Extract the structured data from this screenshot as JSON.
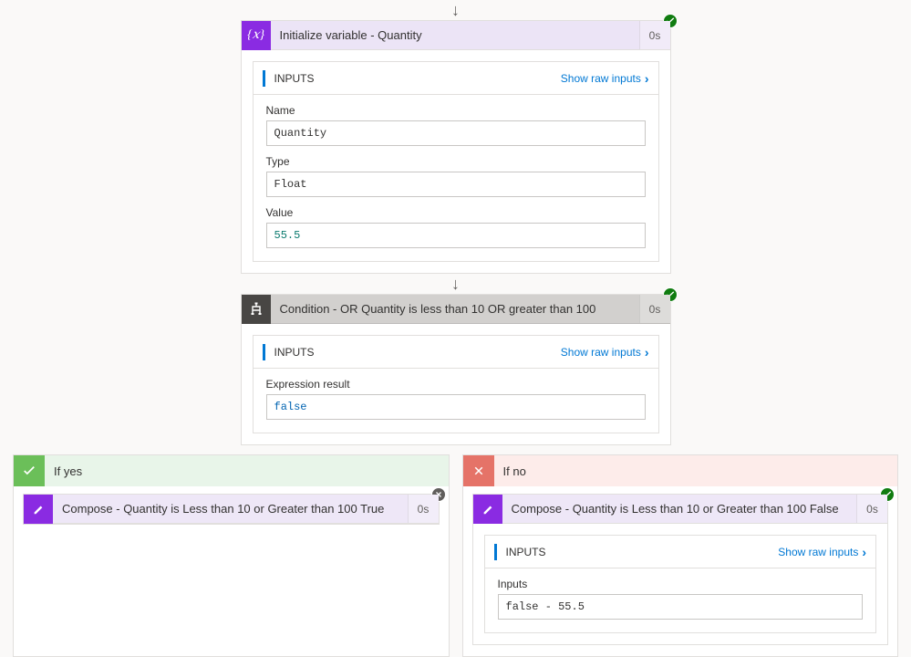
{
  "arrow_glyph": "↓",
  "initVar": {
    "title": "Initialize variable - Quantity",
    "duration": "0s",
    "status": "success",
    "inputs_label": "INPUTS",
    "raw_label": "Show raw inputs",
    "fields": {
      "name_label": "Name",
      "name_value": "Quantity",
      "type_label": "Type",
      "type_value": "Float",
      "value_label": "Value",
      "value_value": "55.5"
    }
  },
  "condition": {
    "title": "Condition - OR Quantity is less than 10 OR greater than 100",
    "duration": "0s",
    "status": "success",
    "inputs_label": "INPUTS",
    "raw_label": "Show raw inputs",
    "expr_label": "Expression result",
    "expr_value": "false"
  },
  "branches": {
    "yes": {
      "label": "If yes",
      "compose_title": "Compose - Quantity is Less than 10 or Greater than 100 True",
      "duration": "0s",
      "status": "skipped"
    },
    "no": {
      "label": "If no",
      "compose_title": "Compose - Quantity is Less than 10 or Greater than 100 False",
      "duration": "0s",
      "status": "success",
      "inputs_label": "INPUTS",
      "raw_label": "Show raw inputs",
      "inputs_field_label": "Inputs",
      "inputs_field_value": "false - 55.5"
    }
  }
}
